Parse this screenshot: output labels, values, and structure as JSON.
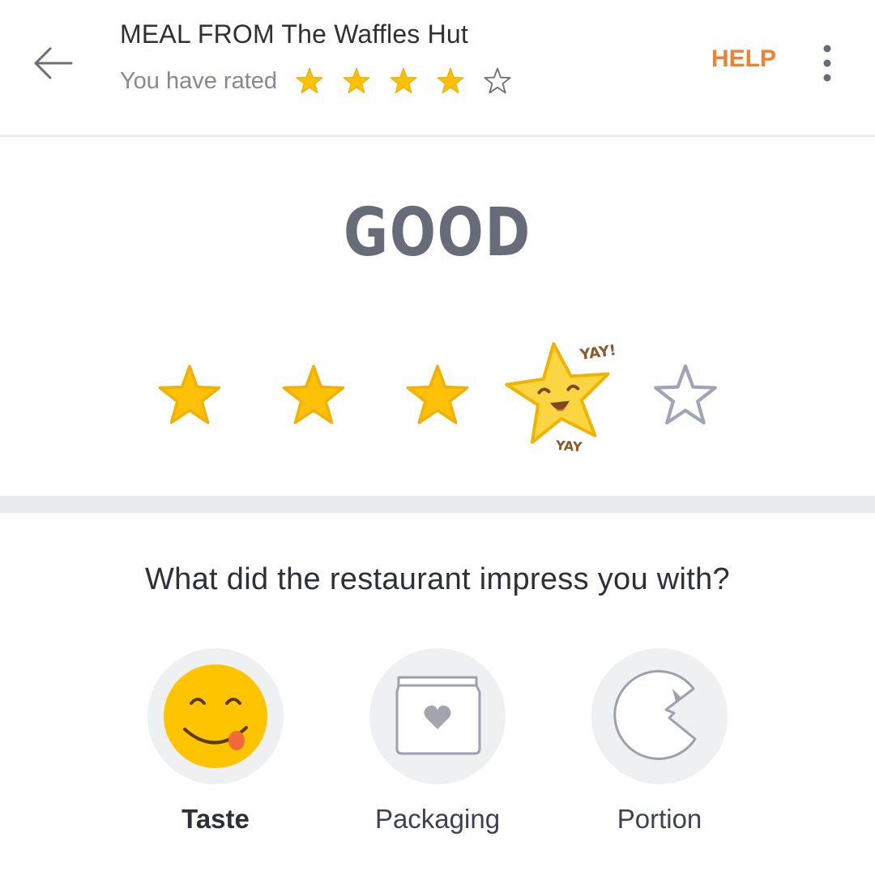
{
  "header": {
    "title": "MEAL FROM The Waffles Hut",
    "subtitle": "You have rated",
    "rating": 4,
    "max_rating": 5,
    "help_label": "HELP",
    "icons": {
      "back": "arrow-left-icon",
      "more": "more-vertical-icon",
      "rated_star": "star-filled-icon",
      "unrated_star": "star-outline-icon"
    }
  },
  "rating_section": {
    "label": "GOOD",
    "selected": 4,
    "sticker_text_top": "YAY!",
    "sticker_text_bottom": "YAY"
  },
  "impress_section": {
    "question": "What did the restaurant impress you with?",
    "options": [
      {
        "label": "Taste",
        "icon": "yum-face-icon",
        "selected": true
      },
      {
        "label": "Packaging",
        "icon": "packaging-bag-icon",
        "selected": false
      },
      {
        "label": "Portion",
        "icon": "portion-pacman-icon",
        "selected": false
      }
    ]
  },
  "colors": {
    "accent": "#ee8232",
    "star_fill": "#ffc107",
    "star_stroke": "#f2b000",
    "star_outline": "#a0a4b6",
    "title_text": "#2e3039",
    "muted_text": "#868892",
    "rating_word": "#686b78"
  }
}
